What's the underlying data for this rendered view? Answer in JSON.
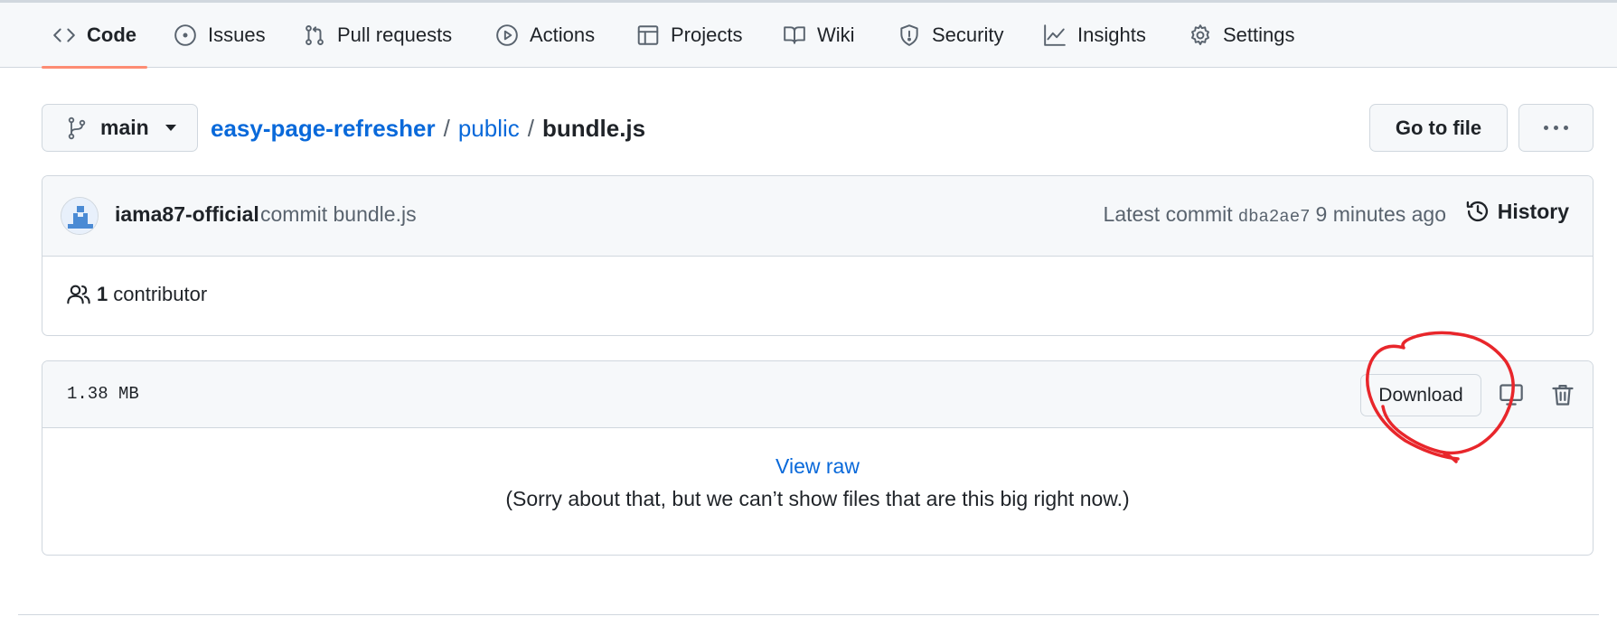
{
  "tabs": [
    {
      "label": "Code",
      "icon": "code-icon",
      "selected": true
    },
    {
      "label": "Issues",
      "icon": "issue-opened-icon"
    },
    {
      "label": "Pull requests",
      "icon": "git-pull-request-icon"
    },
    {
      "label": "Actions",
      "icon": "play-icon"
    },
    {
      "label": "Projects",
      "icon": "table-icon"
    },
    {
      "label": "Wiki",
      "icon": "book-icon"
    },
    {
      "label": "Security",
      "icon": "shield-icon"
    },
    {
      "label": "Insights",
      "icon": "graph-icon"
    },
    {
      "label": "Settings",
      "icon": "gear-icon"
    }
  ],
  "branch": {
    "name": "main",
    "icon": "git-branch-icon"
  },
  "breadcrumb": {
    "repo": "easy-page-refresher",
    "folder": "public",
    "separator": "/",
    "file": "bundle.js"
  },
  "actions": {
    "go_to_file": "Go to file",
    "more_icon": "kebab-horizontal-icon"
  },
  "commit": {
    "author": "iama87-official",
    "message": "commit bundle.js",
    "latest_label": "Latest commit",
    "sha": "dba2ae7",
    "time": "9 minutes ago",
    "history_label": "History",
    "contributors_count": "1",
    "contributors_label": "contributor"
  },
  "file": {
    "size": "1.38 MB",
    "download_label": "Download",
    "view_raw": "View raw",
    "too_big_message": "(Sorry about that, but we can’t show files that are this big right now.)",
    "desktop_icon": "device-desktop-icon",
    "delete_icon": "trash-icon"
  },
  "colors": {
    "accent_underline": "#fd8c73",
    "link": "#0969da",
    "annotation": "#e8262b"
  }
}
